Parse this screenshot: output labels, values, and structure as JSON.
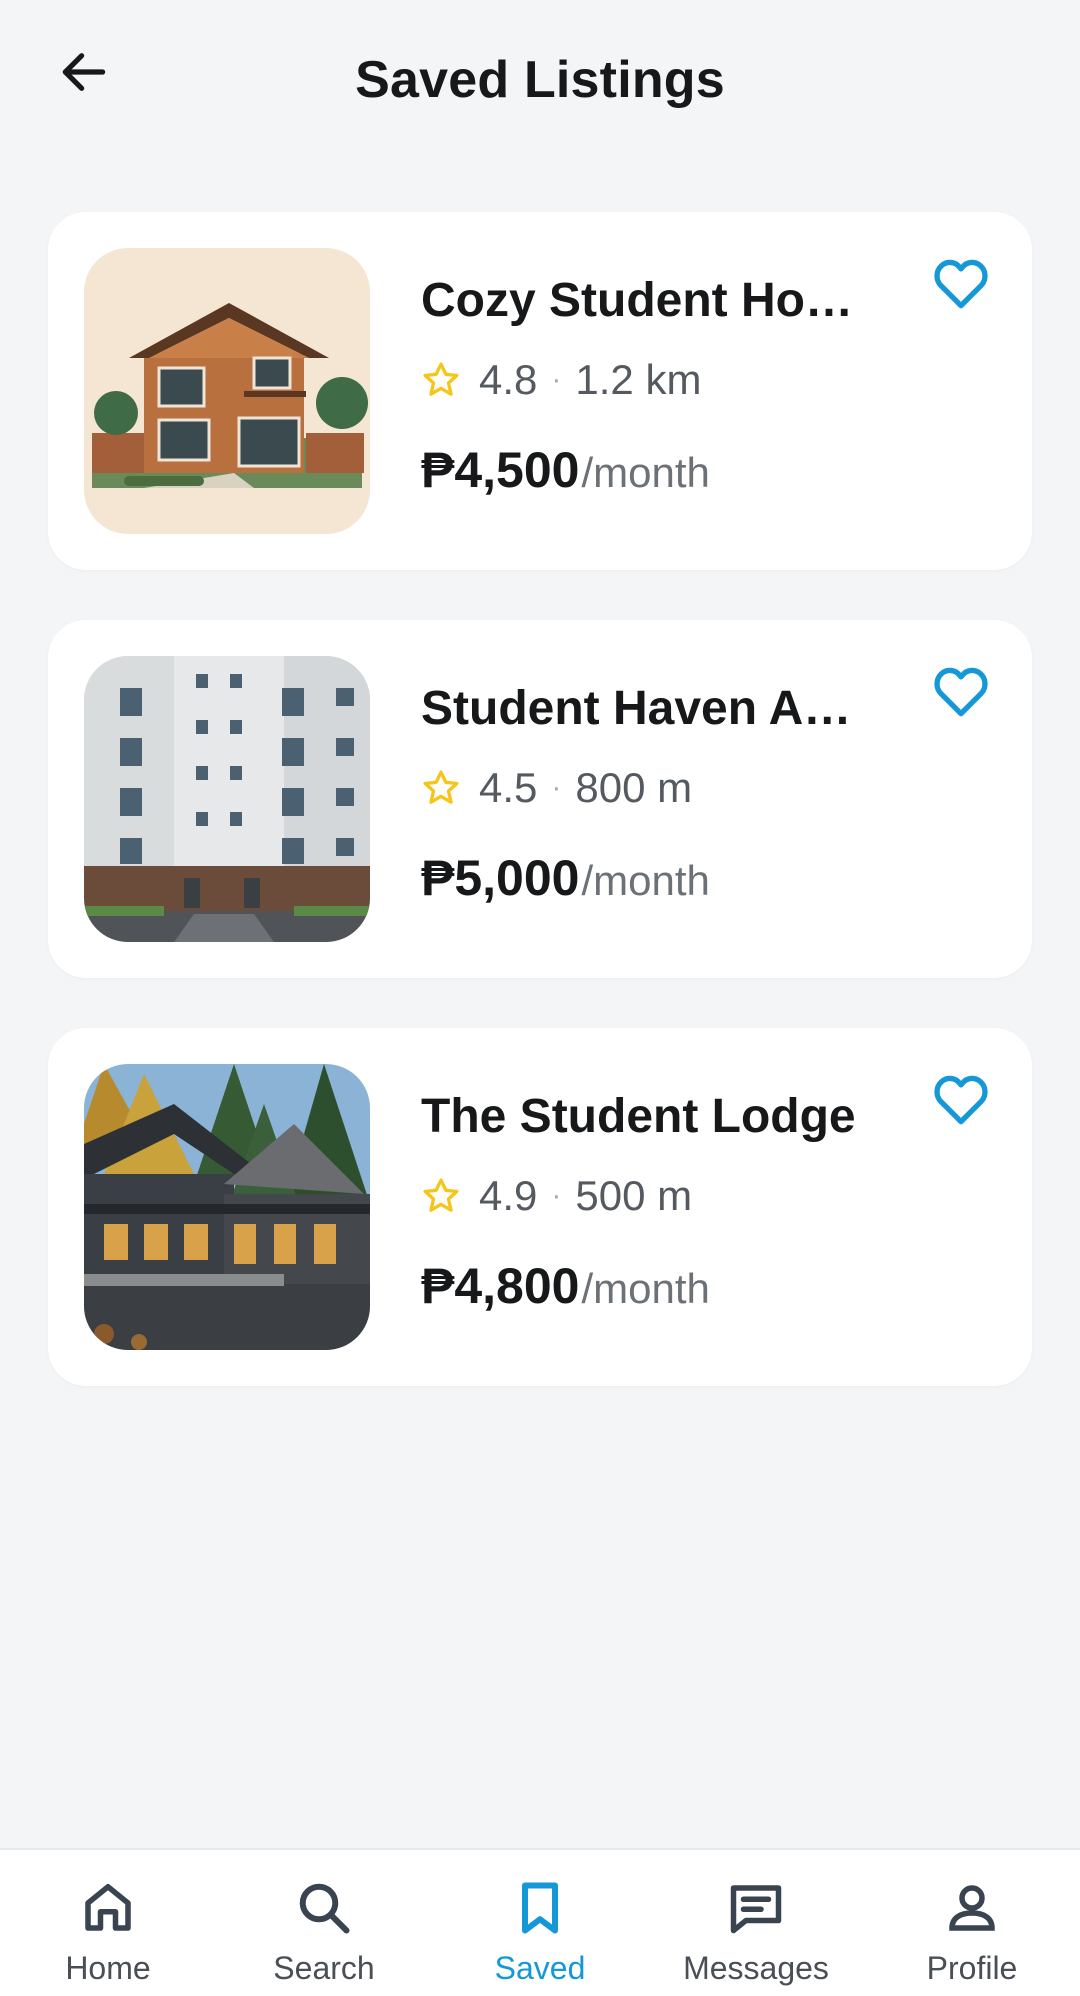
{
  "header": {
    "title": "Saved Listings",
    "back_icon": "arrow-left-icon"
  },
  "listings": [
    {
      "title": "Cozy Student Ho…",
      "rating": "4.8",
      "distance": "1.2 km",
      "price": "₱4,500",
      "price_unit": "/month",
      "image": "two-story-wooden-house-illustration"
    },
    {
      "title": "Student Haven A…",
      "rating": "4.5",
      "distance": "800 m",
      "price": "₱5,000",
      "price_unit": "/month",
      "image": "apartment-building-photo"
    },
    {
      "title": "The Student Lodge",
      "rating": "4.9",
      "distance": "500 m",
      "price": "₱4,800",
      "price_unit": "/month",
      "image": "lodge-in-forest-photo"
    }
  ],
  "nav": [
    {
      "label": "Home",
      "icon": "home-icon"
    },
    {
      "label": "Search",
      "icon": "search-icon"
    },
    {
      "label": "Saved",
      "icon": "bookmark-icon",
      "active": true
    },
    {
      "label": "Messages",
      "icon": "chat-icon"
    },
    {
      "label": "Profile",
      "icon": "person-icon"
    }
  ],
  "colors": {
    "accent": "#1598d8",
    "star": "#f5c518",
    "background": "#f4f5f7",
    "card": "#ffffff"
  }
}
